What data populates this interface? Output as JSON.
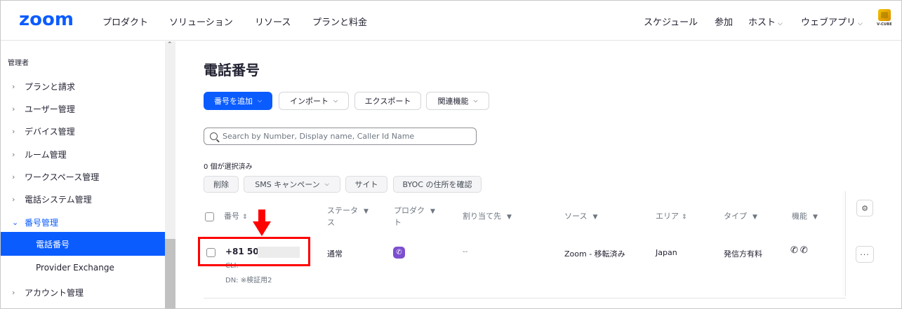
{
  "brand": {
    "logo": "zoom",
    "accent": "#0b5cff",
    "partner_logo_text": "V-CUBE"
  },
  "topnav": {
    "left": [
      "プロダクト",
      "ソリューション",
      "リソース",
      "プランと料金"
    ],
    "schedule": "スケジュール",
    "join": "参加",
    "host": "ホスト",
    "webapp": "ウェブアプリ"
  },
  "sidebar": {
    "header": "管理者",
    "items": [
      {
        "label": "プランと請求"
      },
      {
        "label": "ユーザー管理"
      },
      {
        "label": "デバイス管理"
      },
      {
        "label": "ルーム管理"
      },
      {
        "label": "ワークスペース管理"
      },
      {
        "label": "電話システム管理"
      },
      {
        "label": "番号管理"
      }
    ],
    "subitems": [
      {
        "label": "電話番号",
        "active": true
      },
      {
        "label": "Provider Exchange",
        "active": false
      }
    ],
    "after": {
      "label": "アカウント管理"
    }
  },
  "main": {
    "title": "電話番号",
    "toolbar": {
      "add": "番号を追加",
      "import": "インポート",
      "export": "エクスポート",
      "related": "関連機能"
    },
    "search_placeholder": "Search by Number, Display name, Caller Id Name",
    "selected_count": "0 個が選択済み",
    "bulk": {
      "delete": "削除",
      "sms": "SMS キャンペーン",
      "site": "サイト",
      "byoc": "BYOC の住所を確認"
    },
    "columns": {
      "number": "番号",
      "status_1": "ステータ",
      "status_2": "ス",
      "product_1": "プロダク",
      "product_2": "ト",
      "assigned": "割り当て先",
      "source": "ソース",
      "area": "エリア",
      "type": "タイプ",
      "features": "機能"
    },
    "rows": [
      {
        "number": "+81 50-",
        "cli": "CLI: --",
        "dn": "DN: ※検証用2",
        "status": "通常",
        "assigned": "--",
        "source": "Zoom - 移転済み",
        "area": "Japan",
        "type": "発信方有料"
      }
    ]
  }
}
